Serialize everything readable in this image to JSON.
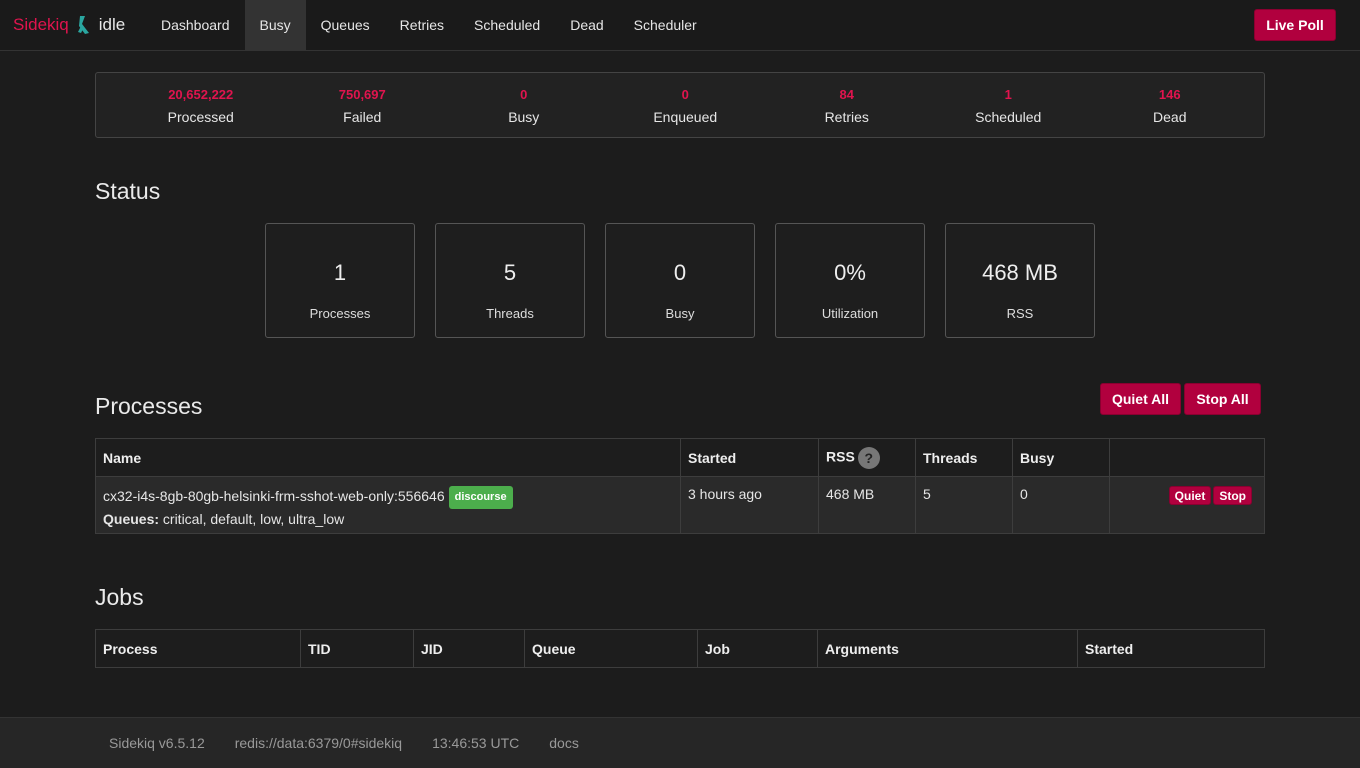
{
  "brand": {
    "name": "Sidekiq",
    "state": "idle"
  },
  "nav": [
    {
      "label": "Dashboard",
      "active": false
    },
    {
      "label": "Busy",
      "active": true
    },
    {
      "label": "Queues",
      "active": false
    },
    {
      "label": "Retries",
      "active": false
    },
    {
      "label": "Scheduled",
      "active": false
    },
    {
      "label": "Dead",
      "active": false
    },
    {
      "label": "Scheduler",
      "active": false
    }
  ],
  "live_poll_label": "Live Poll",
  "summary": [
    {
      "count": "20,652,222",
      "label": "Processed"
    },
    {
      "count": "750,697",
      "label": "Failed"
    },
    {
      "count": "0",
      "label": "Busy"
    },
    {
      "count": "0",
      "label": "Enqueued"
    },
    {
      "count": "84",
      "label": "Retries"
    },
    {
      "count": "1",
      "label": "Scheduled"
    },
    {
      "count": "146",
      "label": "Dead"
    }
  ],
  "status": {
    "heading": "Status",
    "cards": [
      {
        "value": "1",
        "label": "Processes"
      },
      {
        "value": "5",
        "label": "Threads"
      },
      {
        "value": "0",
        "label": "Busy"
      },
      {
        "value": "0%",
        "label": "Utilization"
      },
      {
        "value": "468 MB",
        "label": "RSS"
      }
    ]
  },
  "processes": {
    "heading": "Processes",
    "quiet_all": "Quiet All",
    "stop_all": "Stop All",
    "columns": [
      "Name",
      "Started",
      "RSS",
      "Threads",
      "Busy",
      ""
    ],
    "help_glyph": "?",
    "rows": [
      {
        "name": "cx32-i4s-8gb-80gb-helsinki-frm-sshot-web-only:556646",
        "tag": "discourse",
        "queues_label": "Queues:",
        "queues": "critical, default, low, ultra_low",
        "started": "3 hours ago",
        "rss": "468 MB",
        "threads": "5",
        "busy": "0",
        "quiet": "Quiet",
        "stop": "Stop"
      }
    ]
  },
  "jobs": {
    "heading": "Jobs",
    "columns": [
      "Process",
      "TID",
      "JID",
      "Queue",
      "Job",
      "Arguments",
      "Started"
    ]
  },
  "footer": {
    "version": "Sidekiq v6.5.12",
    "redis": "redis://data:6379/0#sidekiq",
    "time": "13:46:53 UTC",
    "docs": "docs"
  },
  "colors": {
    "accent": "#b1003e",
    "count": "#e0144e",
    "tag": "#4cae4c"
  }
}
